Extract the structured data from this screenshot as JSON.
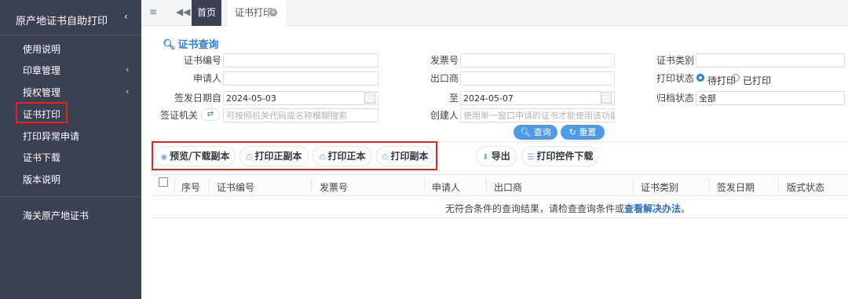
{
  "sidebar": {
    "title": "原产地证书自助打印",
    "caret": "‹",
    "items": [
      {
        "label": "使用说明"
      },
      {
        "label": "印章管理",
        "caret": "‹"
      },
      {
        "label": "授权管理",
        "caret": "‹"
      },
      {
        "label": "证书打印",
        "active": true
      },
      {
        "label": "打印异常申请"
      },
      {
        "label": "证书下载"
      },
      {
        "label": "版本说明"
      }
    ],
    "bottom_item": "海关原产地证书"
  },
  "topbar": {
    "menu_icon": "hamburger-icon",
    "back_icon": "double-chevron-left-icon",
    "tabs": [
      {
        "label": "首页"
      },
      {
        "label": "证书打印"
      }
    ]
  },
  "query": {
    "title": "证书查询",
    "fields": {
      "cert_no": {
        "label": "证书编号",
        "value": ""
      },
      "invoice_no": {
        "label": "发票号",
        "value": ""
      },
      "cert_type": {
        "label": "证书类别",
        "value": ""
      },
      "applicant": {
        "label": "申请人",
        "value": ""
      },
      "exporter": {
        "label": "出口商",
        "value": ""
      },
      "print_status": {
        "label": "打印状态",
        "options": [
          "待打印",
          "已打印"
        ],
        "selected": "待打印"
      },
      "issue_date_from": {
        "label": "签发日期自",
        "value": "2024-05-03"
      },
      "issue_date_to": {
        "label": "至",
        "value": "2024-05-07"
      },
      "archive_status": {
        "label": "归档状态",
        "value": "全部"
      },
      "visa_org": {
        "label": "签证机关",
        "placeholder": "可按照机关代码或名称模糊搜索"
      },
      "creator": {
        "label": "创建人",
        "placeholder": "使用单一窗口申请的证书才能使用该功能"
      }
    },
    "search_btn": "查询",
    "reset_btn": "重置"
  },
  "actions": {
    "preview": "预览/下载副本",
    "print_orig_copy": "打印正副本",
    "print_orig": "打印正本",
    "print_copy": "打印副本",
    "export": "导出",
    "download_ctrl": "打印控件下载"
  },
  "table": {
    "columns": [
      "序号",
      "证书编号",
      "发票号",
      "申请人",
      "出口商",
      "证书类别",
      "签发日期",
      "版式状态"
    ],
    "empty_text": "无符合条件的查询结果，请检查查询条件或",
    "empty_link": "查看解决办法",
    "empty_tail": "。"
  },
  "colors": {
    "sidebar_bg": "#3b4153",
    "accent": "#2b7fd6",
    "highlight": "#e1251b"
  }
}
